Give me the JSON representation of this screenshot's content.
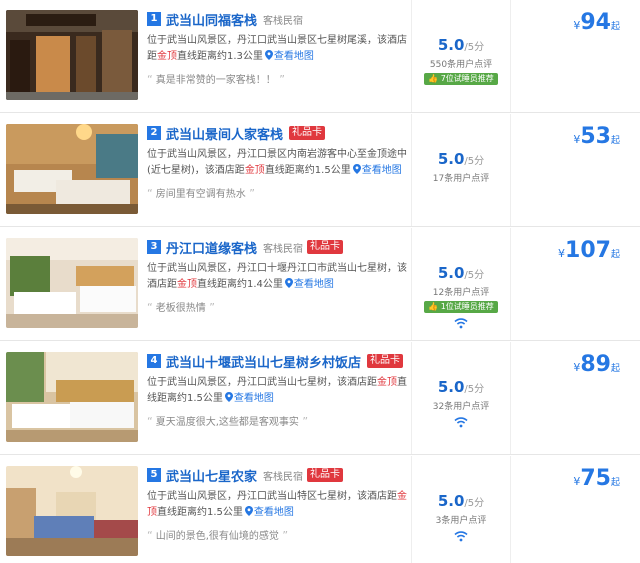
{
  "listings": [
    {
      "index": "1",
      "name": "武当山同福客栈",
      "type": "客栈民宿",
      "gift": "",
      "desc_before": "位于武当山风景区，丹江口武当山景区七星树尾溪，该酒店距",
      "desc_hl": "金顶",
      "desc_after": "直线距离约1.3公里",
      "map": "查看地图",
      "quote": "真是非常赞的一家客栈！！",
      "score": "5.0",
      "score_of": "/5分",
      "reviews": "550条用户点评",
      "recommend": "7位试睡员推荐",
      "price_yen": "¥",
      "price": "94",
      "price_suffix": "起",
      "wifi": false
    },
    {
      "index": "2",
      "name": "武当山景间人家客栈",
      "type": "",
      "gift": "礼品卡",
      "desc_before": "位于武当山风景区，丹江口景区内南岩游客中心至金顶途中(近七星树)，该酒店距",
      "desc_hl": "金顶",
      "desc_after": "直线距离约1.5公里",
      "map": "查看地图",
      "quote": "房间里有空调有热水",
      "score": "5.0",
      "score_of": "/5分",
      "reviews": "17条用户点评",
      "recommend": "",
      "price_yen": "¥",
      "price": "53",
      "price_suffix": "起",
      "wifi": false
    },
    {
      "index": "3",
      "name": "丹江口道缘客栈",
      "type": "客栈民宿",
      "gift": "礼品卡",
      "desc_before": "位于武当山风景区，丹江口十堰丹江口市武当山七星树，该酒店距",
      "desc_hl": "金顶",
      "desc_after": "直线距离约1.4公里",
      "map": "查看地图",
      "quote": "老板很热情",
      "score": "5.0",
      "score_of": "/5分",
      "reviews": "12条用户点评",
      "recommend": "1位试睡员推荐",
      "price_yen": "¥",
      "price": "107",
      "price_suffix": "起",
      "wifi": true
    },
    {
      "index": "4",
      "name": "武当山十堰武当山七星树乡村饭店",
      "type": "",
      "gift": "礼品卡",
      "desc_before": "位于武当山风景区，丹江口武当山七星树，该酒店距",
      "desc_hl": "金顶",
      "desc_after": "直线距离约1.5公里",
      "map": "查看地图",
      "quote": "夏天温度很大,这些都是客观事实",
      "score": "5.0",
      "score_of": "/5分",
      "reviews": "32条用户点评",
      "recommend": "",
      "price_yen": "¥",
      "price": "89",
      "price_suffix": "起",
      "wifi": true
    },
    {
      "index": "5",
      "name": "武当山七星农家",
      "type": "客栈民宿",
      "gift": "礼品卡",
      "desc_before": "位于武当山风景区，丹江口武当山特区七星树，该酒店距",
      "desc_hl": "金顶",
      "desc_after": "直线距离约1.5公里",
      "map": "查看地图",
      "quote": "山间的景色,很有仙境的感觉",
      "score": "5.0",
      "score_of": "/5分",
      "reviews": "3条用户点评",
      "recommend": "",
      "price_yen": "¥",
      "price": "75",
      "price_suffix": "起",
      "wifi": true
    }
  ],
  "colors": {
    "accent_blue": "#2577e3",
    "title_blue": "#1a66c9",
    "highlight_red": "#e0383e",
    "recommend_green": "#57a846"
  },
  "icons": {
    "map": "map-pin-icon",
    "quote": "quote-icon",
    "recommend": "thumbs-up-icon",
    "wifi": "wifi-icon"
  }
}
